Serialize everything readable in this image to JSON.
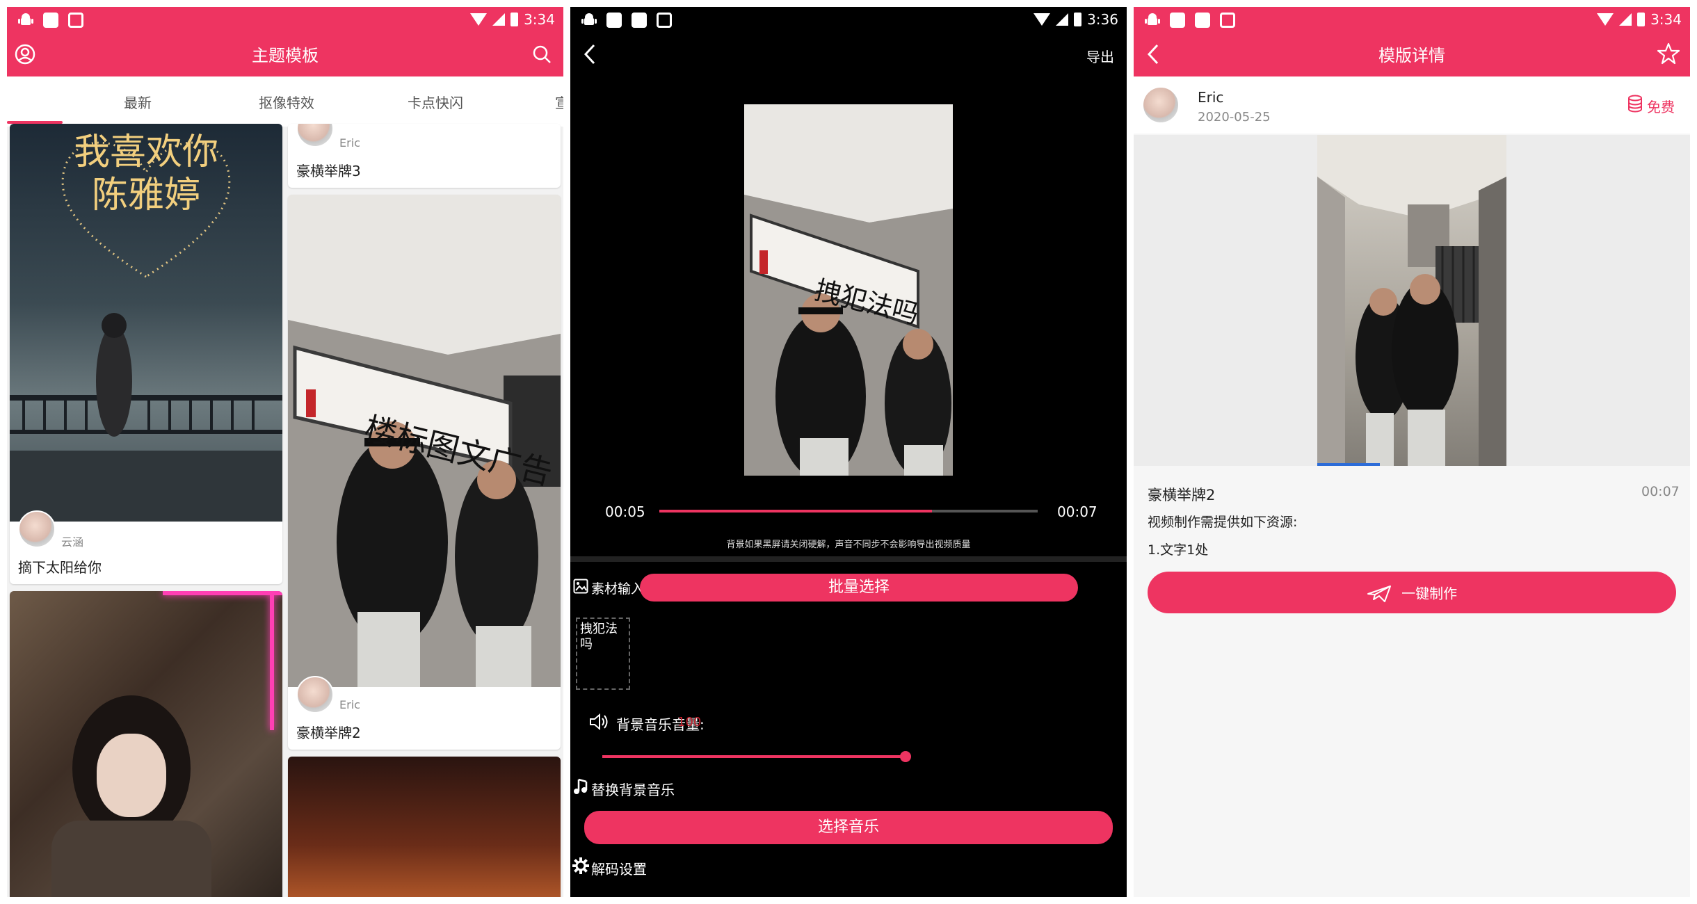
{
  "colors": {
    "accent": "#ee3461",
    "dark": "#000000"
  },
  "screen1": {
    "status_time": "3:34",
    "title": "主题模板",
    "tabs": [
      "最新",
      "抠像特效",
      "卡点快闪",
      "宣"
    ],
    "cards": [
      {
        "image_text": "我喜欢你\n陈雅婷",
        "author": "云涵",
        "title": "摘下太阳给你"
      },
      {
        "author": "Eric",
        "title": "豪横举牌3"
      },
      {
        "author": "Eric",
        "title": "豪横举牌2"
      }
    ]
  },
  "screen2": {
    "status_time": "3:36",
    "export_label": "导出",
    "time_current": "00:05",
    "time_total": "00:07",
    "progress": 0.72,
    "hint": "背景如果黑屏请关闭硬解，声音不同步不会影响导出视频质量",
    "material_input_label": "素材输入",
    "batch_select_label": "批量选择",
    "text_material": "拽犯法吗",
    "bg_volume_label": "背景音乐音量:",
    "bg_volume_value": "100",
    "volume_level": 1.0,
    "replace_music_label": "替换背景音乐",
    "choose_music_label": "选择音乐",
    "decode_settings_label": "解码设置",
    "sign_text": "拽犯法吗"
  },
  "screen3": {
    "status_time": "3:34",
    "title": "模版详情",
    "author": "Eric",
    "date": "2020-05-25",
    "free_label": "免费",
    "template_title": "豪横举牌2",
    "duration": "00:07",
    "resource_desc": "视频制作需提供如下资源:",
    "resource_item": "1.文字1处",
    "make_label": "一键制作"
  },
  "card_sign_text": "楼标图文广告",
  "icons": [
    "android-icon",
    "image-icon",
    "circle-icon",
    "a-icon",
    "wifi-icon",
    "cell-icon",
    "battery-icon",
    "user-icon",
    "search-icon",
    "back-icon",
    "star-icon",
    "coins-icon",
    "image-icon",
    "volume-icon",
    "music-icon",
    "gear-icon",
    "send-icon"
  ]
}
